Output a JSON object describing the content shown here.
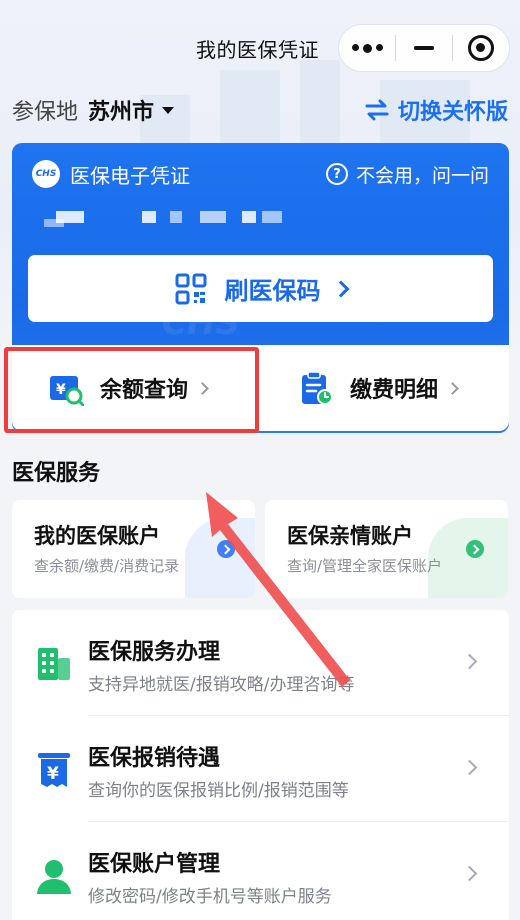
{
  "nav": {
    "title": "我的医保凭证"
  },
  "location": {
    "label": "参保地",
    "city": "苏州市",
    "switch_label": "切换关怀版"
  },
  "card": {
    "title": "医保电子凭证",
    "logo_text": "CHS",
    "help_label": "不会用，问一问",
    "qr_button_label": "刷医保码"
  },
  "actions": {
    "balance_label": "余额查询",
    "payment_label": "缴费明细"
  },
  "section": {
    "title": "医保服务"
  },
  "accounts": [
    {
      "title": "我的医保账户",
      "subtitle": "查余额/缴费/消费记录"
    },
    {
      "title": "医保亲情账户",
      "subtitle": "查询/管理全家医保账户"
    }
  ],
  "services": [
    {
      "title": "医保服务办理",
      "subtitle": "支持异地就医/报销攻略/办理咨询等",
      "icon": "building-icon"
    },
    {
      "title": "医保报销待遇",
      "subtitle": "查询你的医保报销比例/报销范围等",
      "icon": "yuan-receipt-icon"
    },
    {
      "title": "医保账户管理",
      "subtitle": "修改密码/修改手机号等账户服务",
      "icon": "user-icon"
    }
  ],
  "colors": {
    "primary": "#1a6ae8",
    "accent_green": "#1fbf6e",
    "highlight_red": "#ef3c3c"
  }
}
